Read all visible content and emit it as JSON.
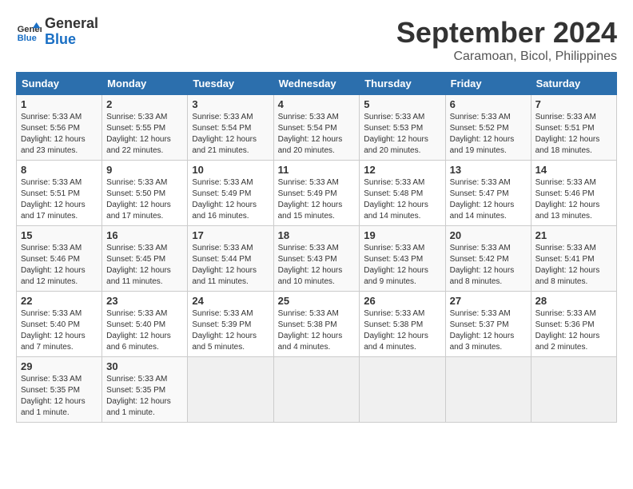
{
  "header": {
    "logo_line1": "General",
    "logo_line2": "Blue",
    "month_year": "September 2024",
    "location": "Caramoan, Bicol, Philippines"
  },
  "columns": [
    "Sunday",
    "Monday",
    "Tuesday",
    "Wednesday",
    "Thursday",
    "Friday",
    "Saturday"
  ],
  "days": [
    {
      "date": "",
      "info": ""
    },
    {
      "date": "",
      "info": ""
    },
    {
      "date": "",
      "info": ""
    },
    {
      "date": "",
      "info": ""
    },
    {
      "date": "",
      "info": ""
    },
    {
      "date": "",
      "info": ""
    },
    {
      "date": "",
      "info": ""
    },
    {
      "date": "1",
      "info": "Sunrise: 5:33 AM\nSunset: 5:56 PM\nDaylight: 12 hours and 23 minutes."
    },
    {
      "date": "2",
      "info": "Sunrise: 5:33 AM\nSunset: 5:55 PM\nDaylight: 12 hours and 22 minutes."
    },
    {
      "date": "3",
      "info": "Sunrise: 5:33 AM\nSunset: 5:54 PM\nDaylight: 12 hours and 21 minutes."
    },
    {
      "date": "4",
      "info": "Sunrise: 5:33 AM\nSunset: 5:54 PM\nDaylight: 12 hours and 20 minutes."
    },
    {
      "date": "5",
      "info": "Sunrise: 5:33 AM\nSunset: 5:53 PM\nDaylight: 12 hours and 20 minutes."
    },
    {
      "date": "6",
      "info": "Sunrise: 5:33 AM\nSunset: 5:52 PM\nDaylight: 12 hours and 19 minutes."
    },
    {
      "date": "7",
      "info": "Sunrise: 5:33 AM\nSunset: 5:51 PM\nDaylight: 12 hours and 18 minutes."
    },
    {
      "date": "8",
      "info": "Sunrise: 5:33 AM\nSunset: 5:51 PM\nDaylight: 12 hours and 17 minutes."
    },
    {
      "date": "9",
      "info": "Sunrise: 5:33 AM\nSunset: 5:50 PM\nDaylight: 12 hours and 17 minutes."
    },
    {
      "date": "10",
      "info": "Sunrise: 5:33 AM\nSunset: 5:49 PM\nDaylight: 12 hours and 16 minutes."
    },
    {
      "date": "11",
      "info": "Sunrise: 5:33 AM\nSunset: 5:49 PM\nDaylight: 12 hours and 15 minutes."
    },
    {
      "date": "12",
      "info": "Sunrise: 5:33 AM\nSunset: 5:48 PM\nDaylight: 12 hours and 14 minutes."
    },
    {
      "date": "13",
      "info": "Sunrise: 5:33 AM\nSunset: 5:47 PM\nDaylight: 12 hours and 14 minutes."
    },
    {
      "date": "14",
      "info": "Sunrise: 5:33 AM\nSunset: 5:46 PM\nDaylight: 12 hours and 13 minutes."
    },
    {
      "date": "15",
      "info": "Sunrise: 5:33 AM\nSunset: 5:46 PM\nDaylight: 12 hours and 12 minutes."
    },
    {
      "date": "16",
      "info": "Sunrise: 5:33 AM\nSunset: 5:45 PM\nDaylight: 12 hours and 11 minutes."
    },
    {
      "date": "17",
      "info": "Sunrise: 5:33 AM\nSunset: 5:44 PM\nDaylight: 12 hours and 11 minutes."
    },
    {
      "date": "18",
      "info": "Sunrise: 5:33 AM\nSunset: 5:43 PM\nDaylight: 12 hours and 10 minutes."
    },
    {
      "date": "19",
      "info": "Sunrise: 5:33 AM\nSunset: 5:43 PM\nDaylight: 12 hours and 9 minutes."
    },
    {
      "date": "20",
      "info": "Sunrise: 5:33 AM\nSunset: 5:42 PM\nDaylight: 12 hours and 8 minutes."
    },
    {
      "date": "21",
      "info": "Sunrise: 5:33 AM\nSunset: 5:41 PM\nDaylight: 12 hours and 8 minutes."
    },
    {
      "date": "22",
      "info": "Sunrise: 5:33 AM\nSunset: 5:40 PM\nDaylight: 12 hours and 7 minutes."
    },
    {
      "date": "23",
      "info": "Sunrise: 5:33 AM\nSunset: 5:40 PM\nDaylight: 12 hours and 6 minutes."
    },
    {
      "date": "24",
      "info": "Sunrise: 5:33 AM\nSunset: 5:39 PM\nDaylight: 12 hours and 5 minutes."
    },
    {
      "date": "25",
      "info": "Sunrise: 5:33 AM\nSunset: 5:38 PM\nDaylight: 12 hours and 4 minutes."
    },
    {
      "date": "26",
      "info": "Sunrise: 5:33 AM\nSunset: 5:38 PM\nDaylight: 12 hours and 4 minutes."
    },
    {
      "date": "27",
      "info": "Sunrise: 5:33 AM\nSunset: 5:37 PM\nDaylight: 12 hours and 3 minutes."
    },
    {
      "date": "28",
      "info": "Sunrise: 5:33 AM\nSunset: 5:36 PM\nDaylight: 12 hours and 2 minutes."
    },
    {
      "date": "29",
      "info": "Sunrise: 5:33 AM\nSunset: 5:35 PM\nDaylight: 12 hours and 1 minute."
    },
    {
      "date": "30",
      "info": "Sunrise: 5:33 AM\nSunset: 5:35 PM\nDaylight: 12 hours and 1 minute."
    },
    {
      "date": "",
      "info": ""
    },
    {
      "date": "",
      "info": ""
    },
    {
      "date": "",
      "info": ""
    },
    {
      "date": "",
      "info": ""
    },
    {
      "date": "",
      "info": ""
    }
  ]
}
